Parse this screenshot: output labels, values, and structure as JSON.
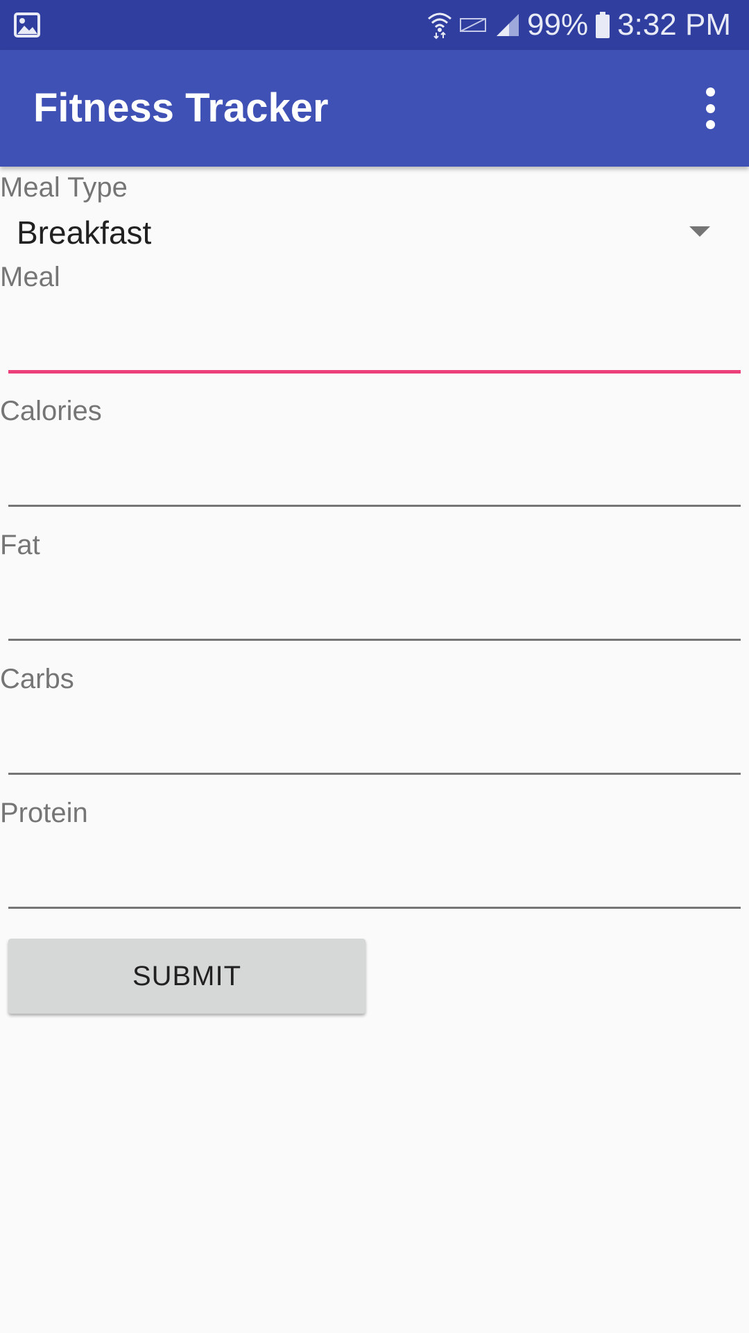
{
  "status_bar": {
    "battery": "99%",
    "time": "3:32 PM",
    "icons": [
      "gallery-icon",
      "wifi-icon",
      "no-sim-icon",
      "signal-icon",
      "battery-icon"
    ]
  },
  "app_bar": {
    "title": "Fitness Tracker",
    "menu_icon": "more-vert-icon"
  },
  "form": {
    "meal_type": {
      "label": "Meal Type",
      "selected": "Breakfast"
    },
    "meal": {
      "label": "Meal",
      "value": ""
    },
    "calories": {
      "label": "Calories",
      "value": ""
    },
    "fat": {
      "label": "Fat",
      "value": ""
    },
    "carbs": {
      "label": "Carbs",
      "value": ""
    },
    "protein": {
      "label": "Protein",
      "value": ""
    },
    "submit_label": "SUBMIT"
  },
  "colors": {
    "status_bar": "#303f9f",
    "app_bar": "#3f51b5",
    "accent": "#ec407a",
    "background": "#fafafa",
    "button": "#d6d7d7"
  }
}
